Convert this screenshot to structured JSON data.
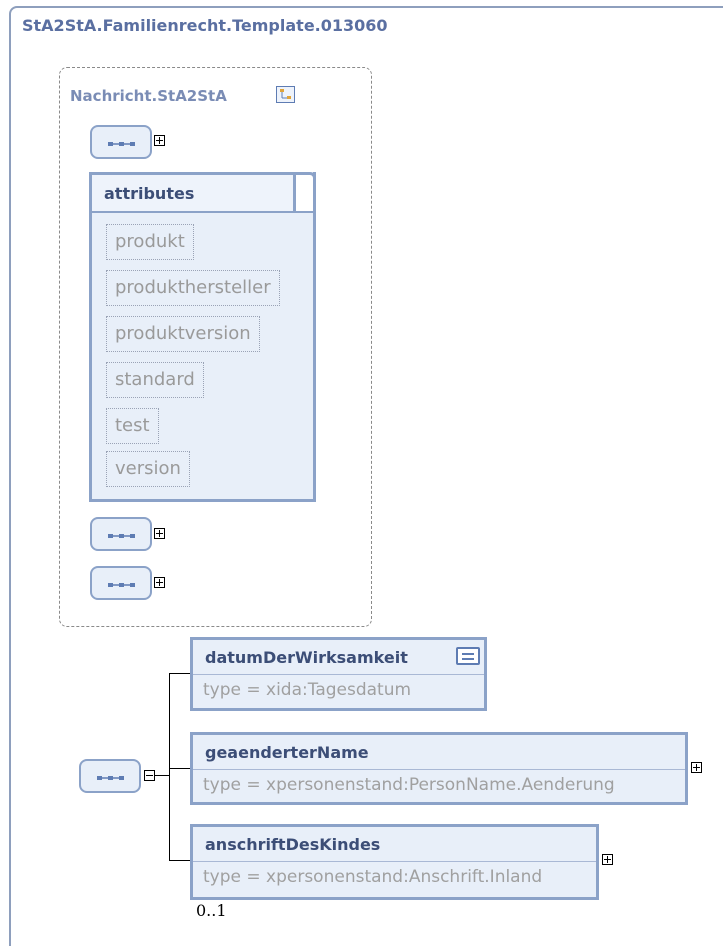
{
  "diagram": {
    "title": "StA2StA.Familienrecht.Template.013060",
    "group": {
      "title": "Nachricht.StA2StA",
      "attributes_title": "attributes",
      "attributes": [
        "produkt",
        "produkthersteller",
        "produktversion",
        "standard",
        "test",
        "version"
      ]
    },
    "elements": [
      {
        "name": "datumDerWirksamkeit",
        "type": "type = xida:Tagesdatum"
      },
      {
        "name": "geaenderterName",
        "type": "type = xpersonenstand:PersonName.Aenderung"
      },
      {
        "name": "anschriftDesKindes",
        "type": "type = xpersonenstand:Anschrift.Inland",
        "cardinality": "0..1"
      }
    ]
  },
  "icons": {
    "tree": "type-tree-icon",
    "documentation": "documentation-icon",
    "sequence": "sequence-compositor-icon",
    "expand": "expand-plus-icon",
    "collapse": "collapse-minus-icon"
  },
  "colors": {
    "title": "#5a6fa1",
    "box_border": "#8ba2c8",
    "box_fill": "#e8eff9",
    "element_name": "#3c4e77",
    "muted_text": "#a0a0a0"
  }
}
